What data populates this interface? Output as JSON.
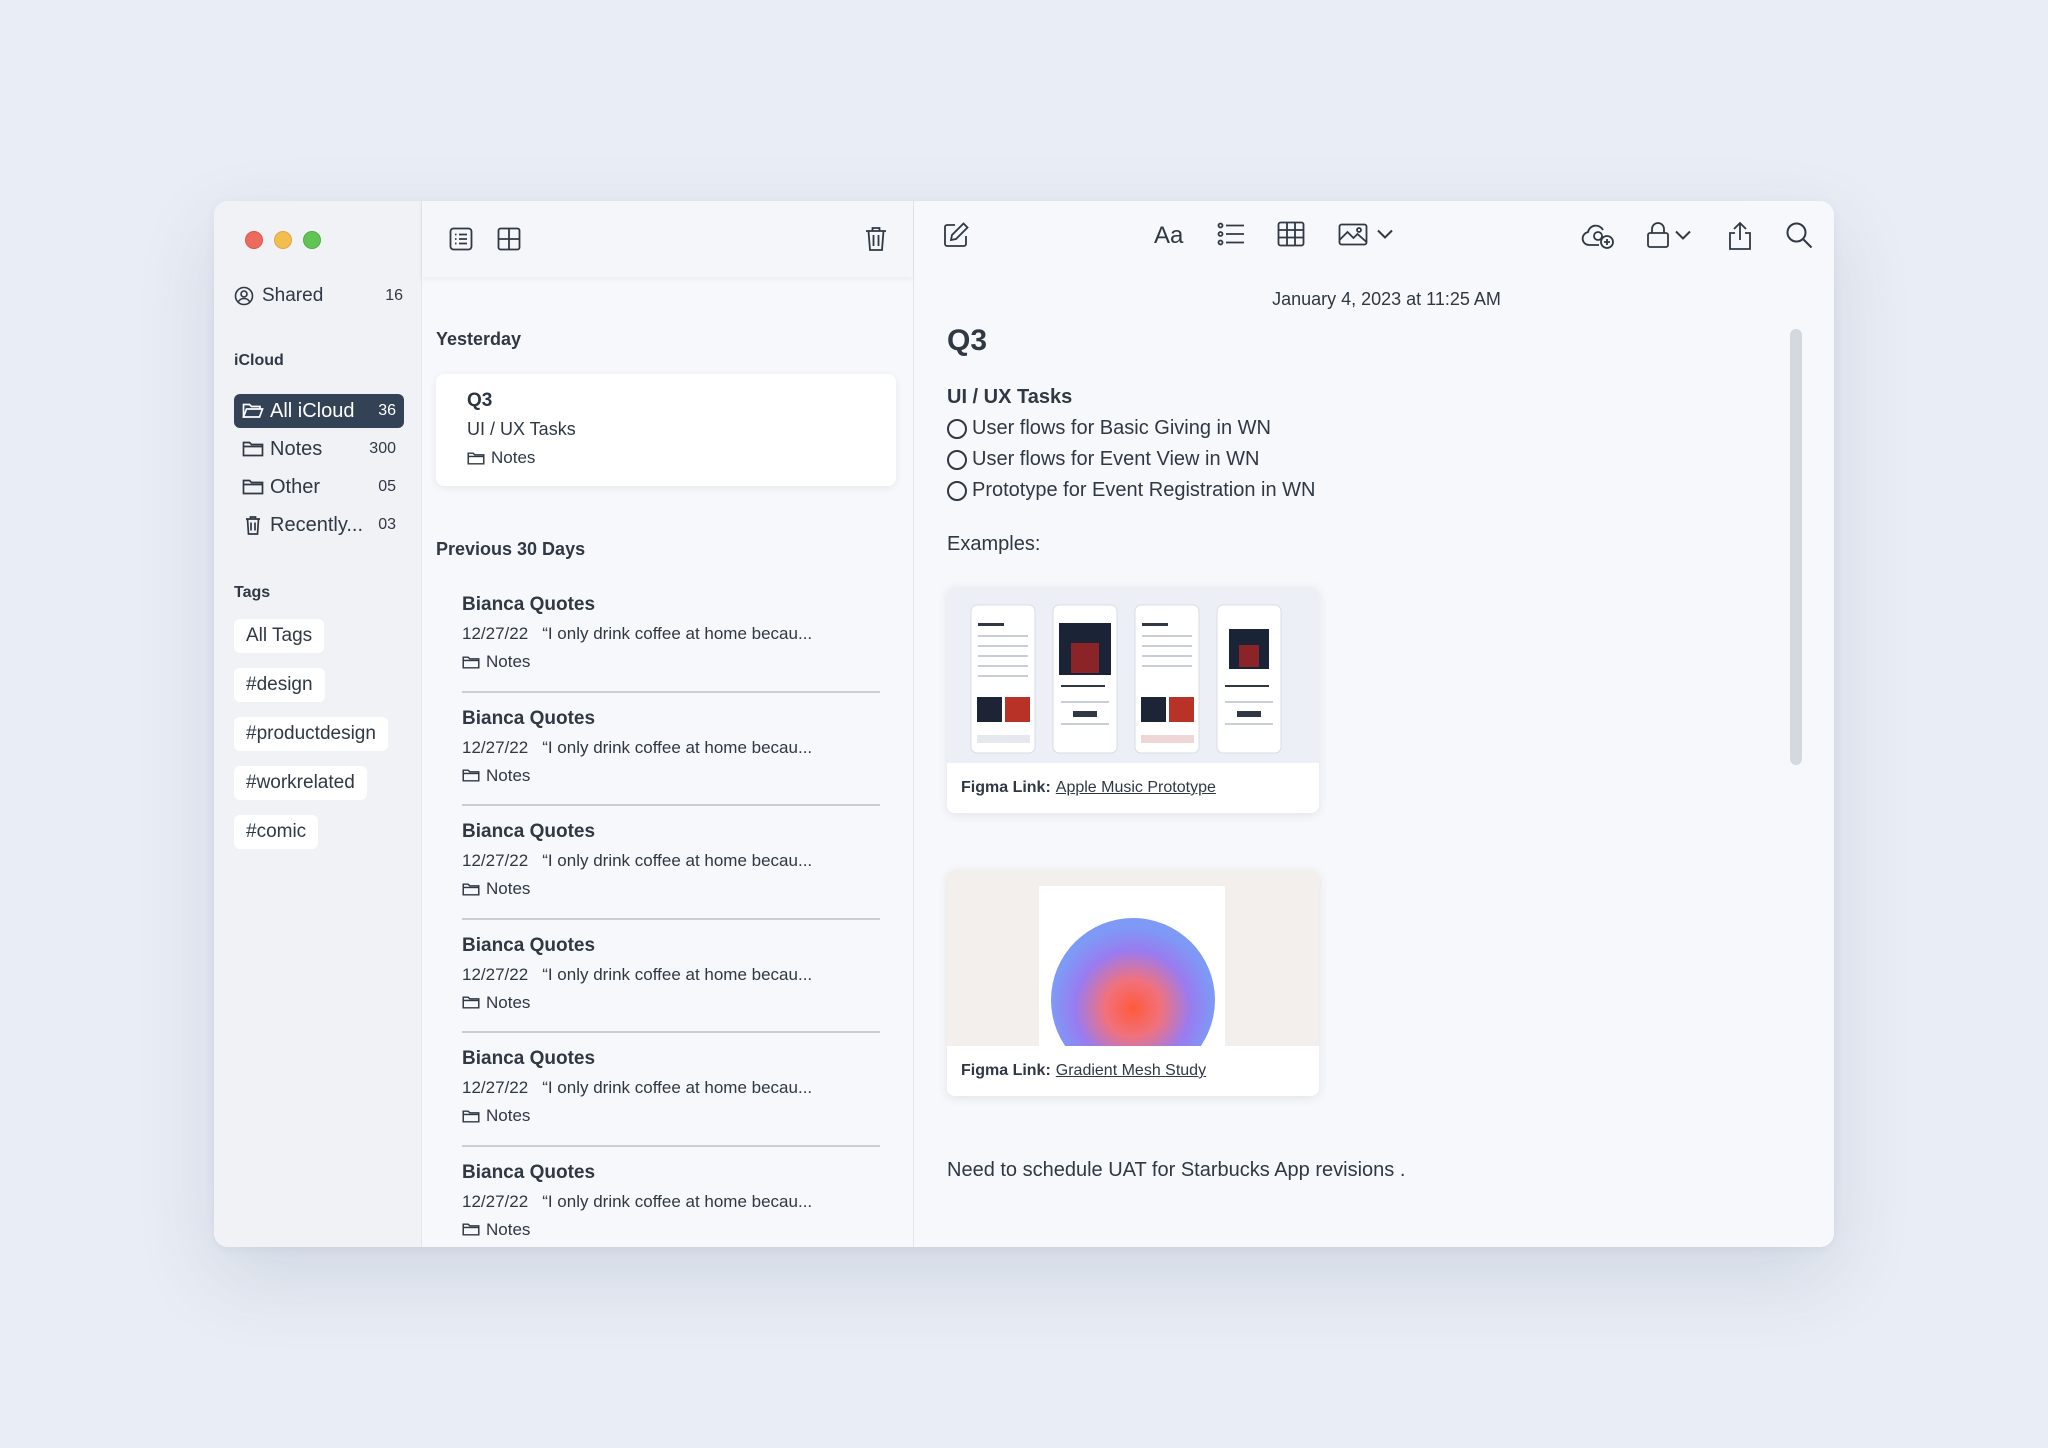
{
  "sidebar": {
    "shared": {
      "label": "Shared",
      "count": "16"
    },
    "icloud_title": "iCloud",
    "folders": [
      {
        "label": "All iCloud",
        "count": "36",
        "active": true,
        "icon": "folder-open-icon"
      },
      {
        "label": "Notes",
        "count": "300",
        "icon": "folder-icon"
      },
      {
        "label": "Other",
        "count": "05",
        "icon": "folder-icon"
      },
      {
        "label": "Recently...",
        "count": "03",
        "icon": "trash-icon"
      }
    ],
    "tags_title": "Tags",
    "tags": [
      "All Tags",
      "#design",
      "#productdesign",
      "#workrelated",
      "#comic"
    ]
  },
  "list": {
    "group_yesterday": "Yesterday",
    "selected": {
      "title": "Q3",
      "subtitle": "UI / UX Tasks",
      "folder": "Notes"
    },
    "group_previous": "Previous 30 Days",
    "items": [
      {
        "title": "Bianca Quotes",
        "date": "12/27/22",
        "preview": "“I only drink coffee at home becau...",
        "folder": "Notes"
      },
      {
        "title": "Bianca Quotes",
        "date": "12/27/22",
        "preview": "“I only drink coffee at home becau...",
        "folder": "Notes"
      },
      {
        "title": "Bianca Quotes",
        "date": "12/27/22",
        "preview": "“I only drink coffee at home becau...",
        "folder": "Notes"
      },
      {
        "title": "Bianca Quotes",
        "date": "12/27/22",
        "preview": "“I only drink coffee at home becau...",
        "folder": "Notes"
      },
      {
        "title": "Bianca Quotes",
        "date": "12/27/22",
        "preview": "“I only drink coffee at home becau...",
        "folder": "Notes"
      },
      {
        "title": "Bianca Quotes",
        "date": "12/27/22",
        "preview": "“I only drink coffee at home becau...",
        "folder": "Notes"
      }
    ]
  },
  "editor": {
    "toolbar": {
      "format_label": "Aa"
    },
    "date": "January 4, 2023 at 11:25 AM",
    "title": "Q3",
    "subheading": "UI / UX Tasks",
    "tasks": [
      "User flows for Basic Giving in WN",
      "User flows for Event View in WN",
      "Prototype for Event Registration in WN"
    ],
    "examples_label": "Examples:",
    "embeds": [
      {
        "prefix": "Figma Link:",
        "link": "Apple Music Prototype"
      },
      {
        "prefix": "Figma Link:",
        "link": "Gradient Mesh Study"
      }
    ],
    "footer_text": "Need to schedule UAT for Starbucks App revisions ."
  },
  "colors": {
    "background": "#e9edf5",
    "window": "#f7f8fb",
    "sidebar": "#f0f2f6",
    "active_folder": "#344255",
    "text": "#2f3843",
    "traffic_red": "#ed6a5e",
    "traffic_yellow": "#f4be4f",
    "traffic_green": "#61c454"
  }
}
